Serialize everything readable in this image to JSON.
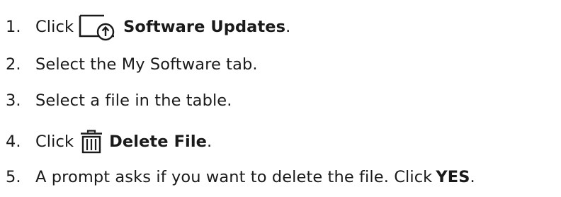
{
  "steps": [
    {
      "number": "1.",
      "prefix": "Click",
      "icon": "software-updates-icon",
      "bold": "Software Updates",
      "suffix": "."
    },
    {
      "number": "2.",
      "text": "Select the My Software tab."
    },
    {
      "number": "3.",
      "text": "Select a file in the table."
    },
    {
      "number": "4.",
      "prefix": "Click",
      "icon": "trash-icon",
      "bold": "Delete File",
      "suffix": "."
    },
    {
      "number": "5.",
      "prefix": "A prompt asks if you want to delete the file. Click",
      "bold": "YES",
      "suffix": "."
    }
  ]
}
